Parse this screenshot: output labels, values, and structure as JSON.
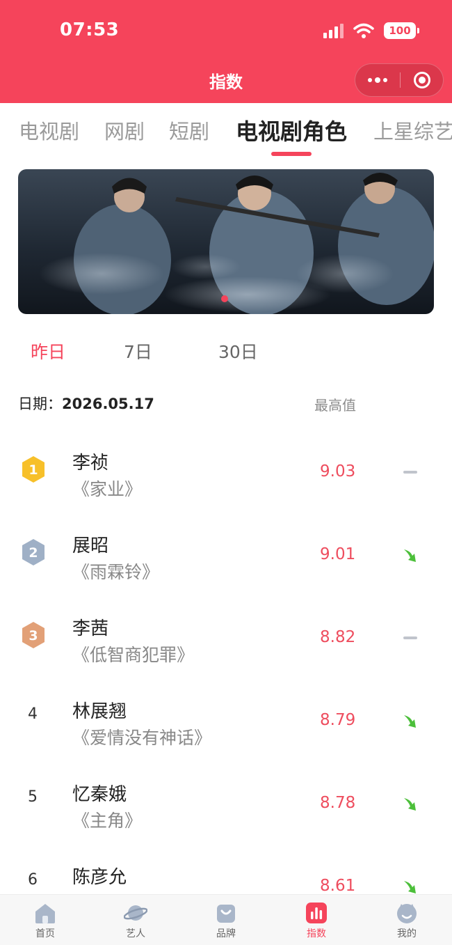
{
  "status_bar": {
    "time": "07:53",
    "battery": "100"
  },
  "nav": {
    "title": "指数"
  },
  "category_tabs": [
    {
      "label": "电视剧",
      "active": false
    },
    {
      "label": "网剧",
      "active": false
    },
    {
      "label": "短剧",
      "active": false
    },
    {
      "label": "电视剧角色",
      "active": true
    },
    {
      "label": "上星综艺",
      "active": false
    }
  ],
  "period_tabs": [
    {
      "label": "昨日",
      "active": true
    },
    {
      "label": "7日",
      "active": false
    },
    {
      "label": "30日",
      "active": false
    }
  ],
  "header": {
    "date_label": "日期：",
    "date_value": "2026.05.17",
    "column_label": "最高值"
  },
  "ranking": [
    {
      "rank": "1",
      "role": "李祯",
      "drama": "《家业》",
      "score": "9.03",
      "trend": "flat"
    },
    {
      "rank": "2",
      "role": "展昭",
      "drama": "《雨霖铃》",
      "score": "9.01",
      "trend": "down"
    },
    {
      "rank": "3",
      "role": "李茜",
      "drama": "《低智商犯罪》",
      "score": "8.82",
      "trend": "flat"
    },
    {
      "rank": "4",
      "role": "林展翘",
      "drama": "《爱情没有神话》",
      "score": "8.79",
      "trend": "down"
    },
    {
      "rank": "5",
      "role": "忆秦娥",
      "drama": "《主角》",
      "score": "8.78",
      "trend": "down"
    },
    {
      "rank": "6",
      "role": "陈彦允",
      "drama": "",
      "score": "8.61",
      "trend": "down"
    }
  ],
  "bottom_tabs": [
    {
      "label": "首页",
      "icon": "home-icon",
      "active": false
    },
    {
      "label": "艺人",
      "icon": "planet-icon",
      "active": false
    },
    {
      "label": "品牌",
      "icon": "bag-icon",
      "active": false
    },
    {
      "label": "指数",
      "icon": "bar-chart-icon",
      "active": true
    },
    {
      "label": "我的",
      "icon": "profile-icon",
      "active": false
    }
  ],
  "colors": {
    "brand": "#f5445b",
    "score": "#ee4d5e",
    "trend_down": "#4cbf3a",
    "trend_flat": "#c0c4cc",
    "gold": "#f7c02a",
    "silver": "#9fb0c6",
    "bronze": "#e2a077"
  }
}
